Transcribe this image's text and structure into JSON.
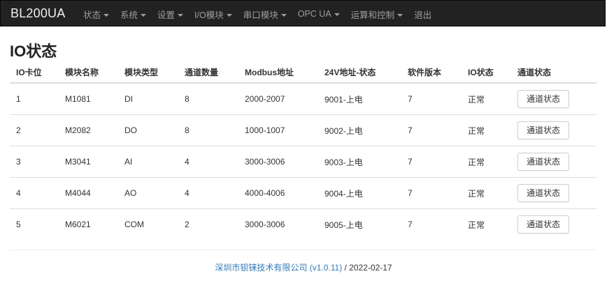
{
  "navbar": {
    "brand": "BL200UA",
    "items": [
      {
        "label": "状态",
        "dropdown": true
      },
      {
        "label": "系统",
        "dropdown": true
      },
      {
        "label": "设置",
        "dropdown": true
      },
      {
        "label": "I/O模块",
        "dropdown": true
      },
      {
        "label": "串口模块",
        "dropdown": true
      },
      {
        "label": "OPC UA",
        "dropdown": true
      },
      {
        "label": "运算和控制",
        "dropdown": true
      },
      {
        "label": "退出",
        "dropdown": false
      }
    ]
  },
  "page": {
    "title": "IO状态"
  },
  "table": {
    "headers": [
      "IO卡位",
      "模块名称",
      "模块类型",
      "通道数量",
      "Modbus地址",
      "24V地址-状态",
      "软件版本",
      "IO状态",
      "通道状态"
    ],
    "button_label": "通道状态",
    "rows": [
      {
        "slot": "1",
        "name": "M1081",
        "type": "DI",
        "channels": "8",
        "modbus": "2000-2007",
        "power": "9001-上电",
        "version": "7",
        "io_status": "正常"
      },
      {
        "slot": "2",
        "name": "M2082",
        "type": "DO",
        "channels": "8",
        "modbus": "1000-1007",
        "power": "9002-上电",
        "version": "7",
        "io_status": "正常"
      },
      {
        "slot": "3",
        "name": "M3041",
        "type": "AI",
        "channels": "4",
        "modbus": "3000-3006",
        "power": "9003-上电",
        "version": "7",
        "io_status": "正常"
      },
      {
        "slot": "4",
        "name": "M4044",
        "type": "AO",
        "channels": "4",
        "modbus": "4000-4006",
        "power": "9004-上电",
        "version": "7",
        "io_status": "正常"
      },
      {
        "slot": "5",
        "name": "M6021",
        "type": "COM",
        "channels": "2",
        "modbus": "3000-3006",
        "power": "9005-上电",
        "version": "7",
        "io_status": "正常"
      }
    ]
  },
  "footer": {
    "company": "深圳市钡铼技术有限公司",
    "version": "(v1.0.11)",
    "separator": " / ",
    "date": "2022-02-17"
  },
  "colors": {
    "navbar_bg": "#222222",
    "nav_text": "#9d9d9d",
    "link": "#337ab7"
  }
}
